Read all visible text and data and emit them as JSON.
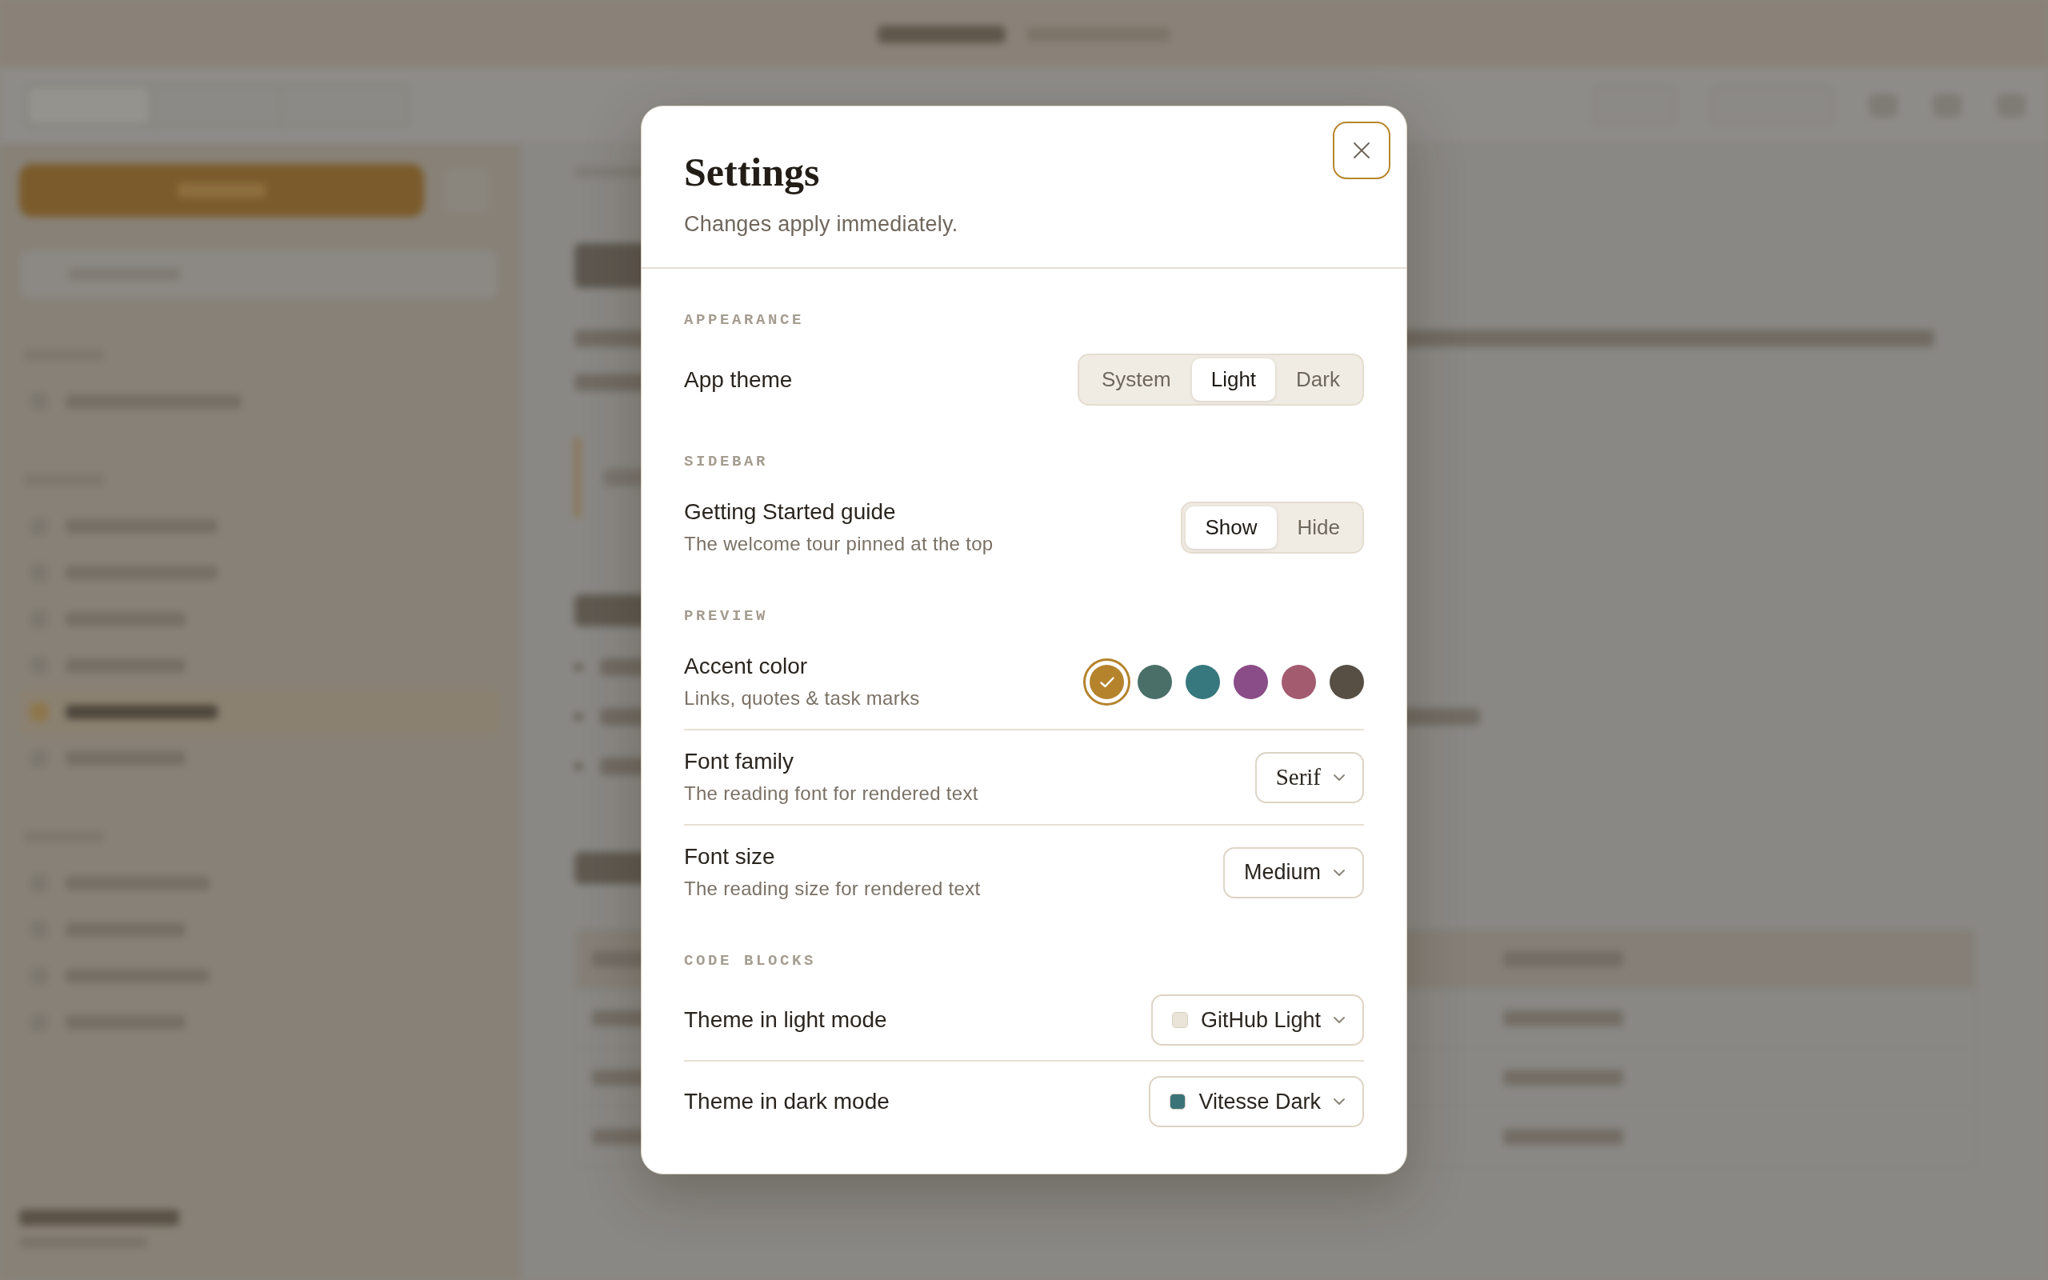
{
  "dialog": {
    "title": "Settings",
    "subtitle": "Changes apply immediately.",
    "sections": [
      {
        "heading": "APPEARANCE",
        "rows": [
          {
            "kind": "segmented",
            "label": "App theme",
            "options": [
              {
                "label": "System",
                "selected": false
              },
              {
                "label": "Light",
                "selected": true
              },
              {
                "label": "Dark",
                "selected": false
              }
            ]
          }
        ]
      },
      {
        "heading": "SIDEBAR",
        "rows": [
          {
            "kind": "segmented",
            "label": "Getting Started guide",
            "description": "The welcome tour pinned at the top",
            "options": [
              {
                "label": "Show",
                "selected": true
              },
              {
                "label": "Hide",
                "selected": false
              }
            ]
          }
        ]
      },
      {
        "heading": "PREVIEW",
        "rows": [
          {
            "kind": "swatches",
            "label": "Accent color",
            "description": "Links, quotes & task marks",
            "swatches": [
              {
                "color": "#b5832c",
                "selected": true
              },
              {
                "color": "#4a6f68",
                "selected": false
              },
              {
                "color": "#37787e",
                "selected": false
              },
              {
                "color": "#8a4d88",
                "selected": false
              },
              {
                "color": "#a35b70",
                "selected": false
              },
              {
                "color": "#574f44",
                "selected": false
              }
            ]
          },
          {
            "kind": "fontselect",
            "label": "Font family",
            "description": "The reading font for rendered text",
            "value": "Serif"
          },
          {
            "kind": "select",
            "label": "Font size",
            "description": "The reading size for rendered text",
            "value": "Medium"
          }
        ]
      },
      {
        "heading": "CODE BLOCKS",
        "rows": [
          {
            "kind": "themeselect",
            "label": "Theme in light mode",
            "value": "GitHub Light",
            "color": "#e9e3d8"
          },
          {
            "kind": "themeselect",
            "label": "Theme in dark mode",
            "value": "Vitesse Dark",
            "color": "#3b7478"
          }
        ]
      }
    ]
  }
}
